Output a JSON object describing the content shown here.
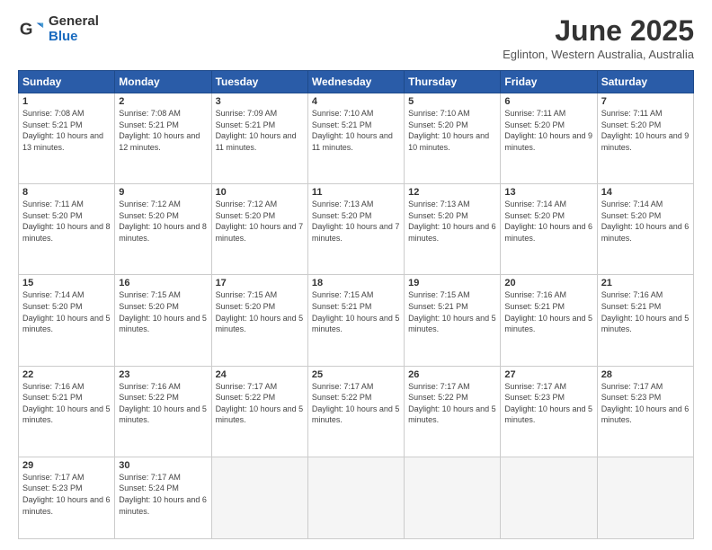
{
  "header": {
    "logo_general": "General",
    "logo_blue": "Blue",
    "title": "June 2025",
    "location": "Eglinton, Western Australia, Australia"
  },
  "weekdays": [
    "Sunday",
    "Monday",
    "Tuesday",
    "Wednesday",
    "Thursday",
    "Friday",
    "Saturday"
  ],
  "weeks": [
    [
      {
        "day": "1",
        "sunrise": "7:08 AM",
        "sunset": "5:21 PM",
        "daylight": "10 hours and 13 minutes."
      },
      {
        "day": "2",
        "sunrise": "7:08 AM",
        "sunset": "5:21 PM",
        "daylight": "10 hours and 12 minutes."
      },
      {
        "day": "3",
        "sunrise": "7:09 AM",
        "sunset": "5:21 PM",
        "daylight": "10 hours and 11 minutes."
      },
      {
        "day": "4",
        "sunrise": "7:10 AM",
        "sunset": "5:21 PM",
        "daylight": "10 hours and 11 minutes."
      },
      {
        "day": "5",
        "sunrise": "7:10 AM",
        "sunset": "5:20 PM",
        "daylight": "10 hours and 10 minutes."
      },
      {
        "day": "6",
        "sunrise": "7:11 AM",
        "sunset": "5:20 PM",
        "daylight": "10 hours and 9 minutes."
      },
      {
        "day": "7",
        "sunrise": "7:11 AM",
        "sunset": "5:20 PM",
        "daylight": "10 hours and 9 minutes."
      }
    ],
    [
      {
        "day": "8",
        "sunrise": "7:11 AM",
        "sunset": "5:20 PM",
        "daylight": "10 hours and 8 minutes."
      },
      {
        "day": "9",
        "sunrise": "7:12 AM",
        "sunset": "5:20 PM",
        "daylight": "10 hours and 8 minutes."
      },
      {
        "day": "10",
        "sunrise": "7:12 AM",
        "sunset": "5:20 PM",
        "daylight": "10 hours and 7 minutes."
      },
      {
        "day": "11",
        "sunrise": "7:13 AM",
        "sunset": "5:20 PM",
        "daylight": "10 hours and 7 minutes."
      },
      {
        "day": "12",
        "sunrise": "7:13 AM",
        "sunset": "5:20 PM",
        "daylight": "10 hours and 6 minutes."
      },
      {
        "day": "13",
        "sunrise": "7:14 AM",
        "sunset": "5:20 PM",
        "daylight": "10 hours and 6 minutes."
      },
      {
        "day": "14",
        "sunrise": "7:14 AM",
        "sunset": "5:20 PM",
        "daylight": "10 hours and 6 minutes."
      }
    ],
    [
      {
        "day": "15",
        "sunrise": "7:14 AM",
        "sunset": "5:20 PM",
        "daylight": "10 hours and 5 minutes."
      },
      {
        "day": "16",
        "sunrise": "7:15 AM",
        "sunset": "5:20 PM",
        "daylight": "10 hours and 5 minutes."
      },
      {
        "day": "17",
        "sunrise": "7:15 AM",
        "sunset": "5:20 PM",
        "daylight": "10 hours and 5 minutes."
      },
      {
        "day": "18",
        "sunrise": "7:15 AM",
        "sunset": "5:21 PM",
        "daylight": "10 hours and 5 minutes."
      },
      {
        "day": "19",
        "sunrise": "7:15 AM",
        "sunset": "5:21 PM",
        "daylight": "10 hours and 5 minutes."
      },
      {
        "day": "20",
        "sunrise": "7:16 AM",
        "sunset": "5:21 PM",
        "daylight": "10 hours and 5 minutes."
      },
      {
        "day": "21",
        "sunrise": "7:16 AM",
        "sunset": "5:21 PM",
        "daylight": "10 hours and 5 minutes."
      }
    ],
    [
      {
        "day": "22",
        "sunrise": "7:16 AM",
        "sunset": "5:21 PM",
        "daylight": "10 hours and 5 minutes."
      },
      {
        "day": "23",
        "sunrise": "7:16 AM",
        "sunset": "5:22 PM",
        "daylight": "10 hours and 5 minutes."
      },
      {
        "day": "24",
        "sunrise": "7:17 AM",
        "sunset": "5:22 PM",
        "daylight": "10 hours and 5 minutes."
      },
      {
        "day": "25",
        "sunrise": "7:17 AM",
        "sunset": "5:22 PM",
        "daylight": "10 hours and 5 minutes."
      },
      {
        "day": "26",
        "sunrise": "7:17 AM",
        "sunset": "5:22 PM",
        "daylight": "10 hours and 5 minutes."
      },
      {
        "day": "27",
        "sunrise": "7:17 AM",
        "sunset": "5:23 PM",
        "daylight": "10 hours and 5 minutes."
      },
      {
        "day": "28",
        "sunrise": "7:17 AM",
        "sunset": "5:23 PM",
        "daylight": "10 hours and 6 minutes."
      }
    ],
    [
      {
        "day": "29",
        "sunrise": "7:17 AM",
        "sunset": "5:23 PM",
        "daylight": "10 hours and 6 minutes."
      },
      {
        "day": "30",
        "sunrise": "7:17 AM",
        "sunset": "5:24 PM",
        "daylight": "10 hours and 6 minutes."
      },
      null,
      null,
      null,
      null,
      null
    ]
  ]
}
